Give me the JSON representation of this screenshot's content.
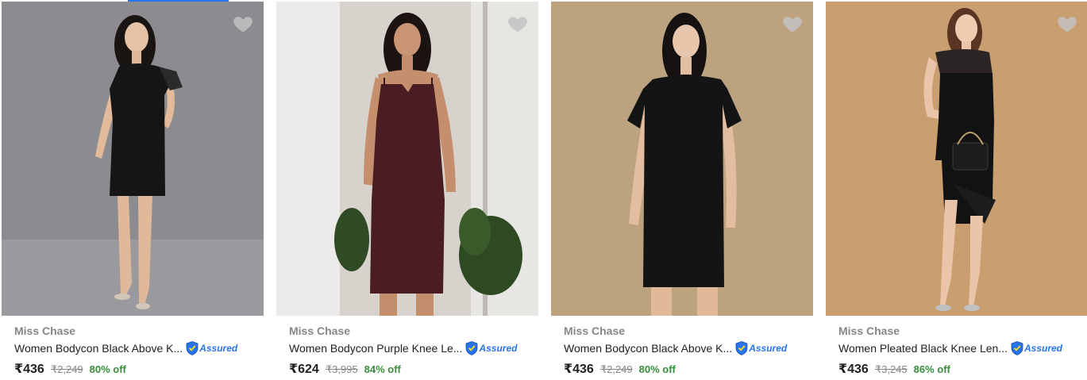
{
  "products": [
    {
      "brand": "Miss Chase",
      "title": "Women Bodycon Black Above K...",
      "price": "₹436",
      "mrp": "₹2,249",
      "discount": "80% off",
      "assured": "Assured",
      "image": {
        "bg": "#8a8a8d",
        "dress": "#151515",
        "style": "bodycon-lace-sleeve"
      }
    },
    {
      "brand": "Miss Chase",
      "title": "Women Bodycon Purple Knee Le...",
      "price": "₹624",
      "mrp": "₹3,995",
      "discount": "84% off",
      "assured": "Assured",
      "image": {
        "bg": "#cfcac3",
        "dress": "#4a1d22",
        "style": "strappy-bodycon"
      }
    },
    {
      "brand": "Miss Chase",
      "title": "Women Bodycon Black Above K...",
      "price": "₹436",
      "mrp": "₹2,249",
      "discount": "80% off",
      "assured": "Assured",
      "image": {
        "bg": "#bfa37e",
        "dress": "#141414",
        "style": "bodycon-lace-sleeve"
      }
    },
    {
      "brand": "Miss Chase",
      "title": "Women Pleated Black Knee Len...",
      "price": "₹436",
      "mrp": "₹3,245",
      "discount": "86% off",
      "assured": "Assured",
      "image": {
        "bg": "#c99d6e",
        "dress": "#121212",
        "style": "lace-yoke-wrap"
      }
    }
  ],
  "colors": {
    "accent": "#2874f0",
    "discount": "#388e3c",
    "muted": "#878787",
    "text": "#212121",
    "wishlist": "#c2c2c2"
  },
  "icons": {
    "wishlist": "heart-icon",
    "assured": "assured-shield-icon"
  }
}
